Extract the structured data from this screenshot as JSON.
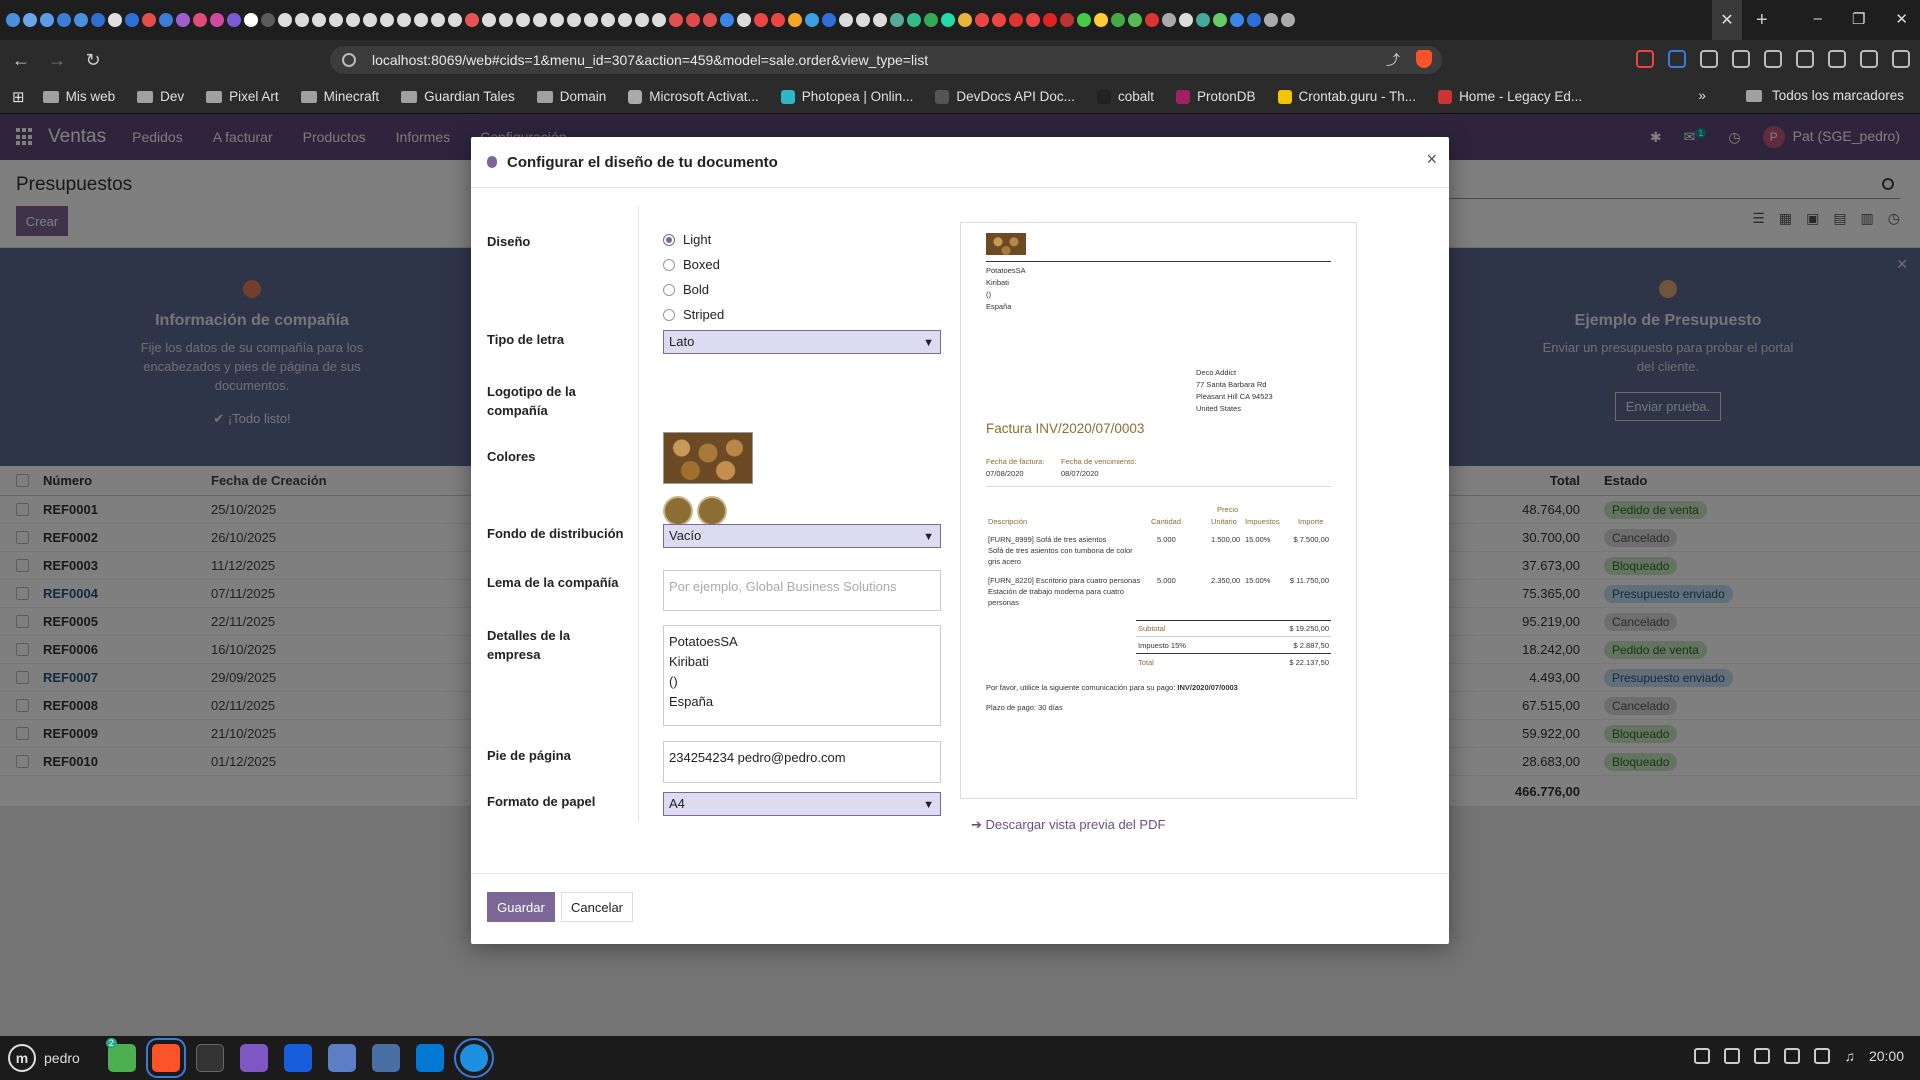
{
  "browser": {
    "url": "localhost:8069/web#cids=1&menu_id=307&action=459&model=sale.order&view_type=list",
    "new_tab": "+",
    "bookmarks": [
      "Mis web",
      "Dev",
      "Pixel Art",
      "Minecraft",
      "Guardian Tales",
      "Domain",
      "Microsoft Activat...",
      "Photopea | Onlin...",
      "DevDocs API Doc...",
      "cobalt",
      "ProtonDB",
      "Crontab.guru - Th...",
      "Home - Legacy Ed..."
    ],
    "bookmarks_more": "»",
    "all_bookmarks": "Todos los marcadores",
    "tab_colors": [
      "#4a8fe0",
      "#6aa6e8",
      "#5c9ce6",
      "#3b7dd8",
      "#4a8fe0",
      "#2f6fd0",
      "#e0e0e0",
      "#2d6fd9",
      "#e54b4b",
      "#3b7dd8",
      "#9d5fd0",
      "#e04a77",
      "#d14aa0",
      "#7c5cd6",
      "#ffffff",
      "#5a5a5a",
      "#dcdcdc",
      "#dcdcdc",
      "#dcdcdc",
      "#dcdcdc",
      "#dcdcdc",
      "#dcdcdc",
      "#dcdcdc",
      "#dcdcdc",
      "#dcdcdc",
      "#dcdcdc",
      "#dcdcdc",
      "#e55353",
      "#dcdcdc",
      "#dcdcdc",
      "#dcdcdc",
      "#dcdcdc",
      "#dcdcdc",
      "#dcdcdc",
      "#dcdcdc",
      "#dcdcdc",
      "#dcdcdc",
      "#dcdcdc",
      "#dcdcdc",
      "#e05050",
      "#e04a4a",
      "#e04f4f",
      "#3a86e8",
      "#dcdcdc",
      "#e44",
      "#e44",
      "#f5a623",
      "#3aa0e0",
      "#2d6fd9",
      "#dcdcdc",
      "#dcdcdc",
      "#dcdcdc",
      "#5a9",
      "#3b8",
      "#34a853",
      "#2da",
      "#e8b33a",
      "#e44",
      "#e44",
      "#d33",
      "#e44",
      "#d22",
      "#b33",
      "#4c4",
      "#fc3",
      "#4a4",
      "#5b5",
      "#d33",
      "#aaa",
      "#ddd",
      "#4a9",
      "#6c6",
      "#3a86e8",
      "#2d6fd9",
      "#aaa",
      "#aaa"
    ]
  },
  "odoo": {
    "brand": "Ventas",
    "menu": [
      "Pedidos",
      "A facturar",
      "Productos",
      "Informes",
      "Configuración"
    ],
    "chat_count": "1",
    "user_initial": "P",
    "user_name": "Pat (SGE_pedro)",
    "breadcrumb": "Presupuestos",
    "create_label": "Crear",
    "banner": {
      "left_title": "Información de compañía",
      "left_desc": "Fije los datos de su compañía para los encabezados y pies de página de sus documentos.",
      "left_done": "¡Todo listo!",
      "right_title": "Ejemplo de Presupuesto",
      "right_desc": "Enviar un presupuesto para probar el portal del cliente.",
      "right_btn": "Enviar prueba."
    },
    "list": {
      "headers": {
        "number": "Número",
        "date": "Fecha de Creación",
        "total": "Total",
        "state": "Estado"
      },
      "rows": [
        {
          "number": "REF0001",
          "date": "25/10/2025",
          "total": "48.764,00",
          "state": "Pedido de venta",
          "kind": "green"
        },
        {
          "number": "REF0002",
          "date": "26/10/2025",
          "total": "30.700,00",
          "state": "Cancelado",
          "kind": "grey"
        },
        {
          "number": "REF0003",
          "date": "11/12/2025",
          "total": "37.673,00",
          "state": "Bloqueado",
          "kind": "green"
        },
        {
          "number": "REF0004",
          "date": "07/11/2025",
          "total": "75.365,00",
          "state": "Presupuesto enviado",
          "kind": "blue"
        },
        {
          "number": "REF0005",
          "date": "22/11/2025",
          "total": "95.219,00",
          "state": "Cancelado",
          "kind": "grey"
        },
        {
          "number": "REF0006",
          "date": "16/10/2025",
          "total": "18.242,00",
          "state": "Pedido de venta",
          "kind": "green"
        },
        {
          "number": "REF0007",
          "date": "29/09/2025",
          "total": "4.493,00",
          "state": "Presupuesto enviado",
          "kind": "blue"
        },
        {
          "number": "REF0008",
          "date": "02/11/2025",
          "total": "67.515,00",
          "state": "Cancelado",
          "kind": "grey"
        },
        {
          "number": "REF0009",
          "date": "21/10/2025",
          "total": "59.922,00",
          "state": "Bloqueado",
          "kind": "green"
        },
        {
          "number": "REF0010",
          "date": "01/12/2025",
          "total": "28.683,00",
          "state": "Bloqueado",
          "kind": "green"
        }
      ],
      "grand_total": "466.776,00"
    }
  },
  "modal": {
    "title": "Configurar el diseño de tu documento",
    "labels": {
      "layout": "Diseño",
      "font": "Tipo de letra",
      "logo": "Logotipo de la compañía",
      "colors": "Colores",
      "background": "Fondo de distribución",
      "tagline": "Lema de la compañía",
      "details": "Detalles de la empresa",
      "footer": "Pie de página",
      "paper": "Formato de papel"
    },
    "layout_options": [
      "Light",
      "Boxed",
      "Bold",
      "Striped"
    ],
    "layout_selected": "Light",
    "font_value": "Lato",
    "background_value": "Vacío",
    "tagline_placeholder": "Por ejemplo, Global Business Solutions",
    "details_lines": [
      "PotatoesSA",
      "Kiribati",
      "()",
      "España"
    ],
    "footer_value": "234254234 pedro@pedro.com",
    "paper_value": "A4",
    "colors": [
      "#8c6d34",
      "#8c6d34"
    ],
    "download_link": "Descargar vista previa del PDF",
    "save_label": "Guardar",
    "cancel_label": "Cancelar",
    "close_glyph": "×"
  },
  "preview": {
    "company_lines": [
      "PotatoesSA",
      "Kiribati",
      "()",
      "España"
    ],
    "customer_lines": [
      "Deco Addict",
      "77 Santa Barbara Rd",
      "Pleasant Hill CA 94523",
      "United States"
    ],
    "invoice_title": "Factura INV/2020/07/0003",
    "invoice_date_label": "Fecha de factura:",
    "invoice_date": "07/08/2020",
    "due_date_label": "Fecha de vencimiento:",
    "due_date": "08/07/2020",
    "col_desc": "Descripción",
    "col_qty": "Cantidad",
    "col_price_1": "Precio",
    "col_price_2": "Unitario",
    "col_tax": "Impuestos",
    "col_amount": "Importe",
    "items": [
      {
        "desc": "[FURN_8999] Sofá de tres asientos",
        "desc2": "Sofá de tres asientos con tumbona de color",
        "desc3": "gris acero",
        "qty": "5.000",
        "price": "1.500,00",
        "tax": "15.00%",
        "amount": "$ 7.500,00"
      },
      {
        "desc": "[FURN_8220] Escritorio para cuatro personas",
        "desc2": "Estación de trabajo moderna para cuatro",
        "desc3": "personas",
        "qty": "5.000",
        "price": "2.350,00",
        "tax": "15.00%",
        "amount": "$ 11.750,00"
      }
    ],
    "subtotal_label": "Subtotal",
    "subtotal": "$ 19.250,00",
    "tax_label": "Impuesto 15%",
    "tax": "$ 2.887,50",
    "total_label": "Total",
    "total": "$ 22.137,50",
    "payment_comm": "Por favor, utilice la siguiente comunicación para su pago:",
    "payment_ref": "INV/2020/07/0003",
    "payment_terms": "Plazo de pago: 30 días"
  },
  "taskbar": {
    "user": "pedro",
    "badge": "2",
    "time": "20:00"
  }
}
